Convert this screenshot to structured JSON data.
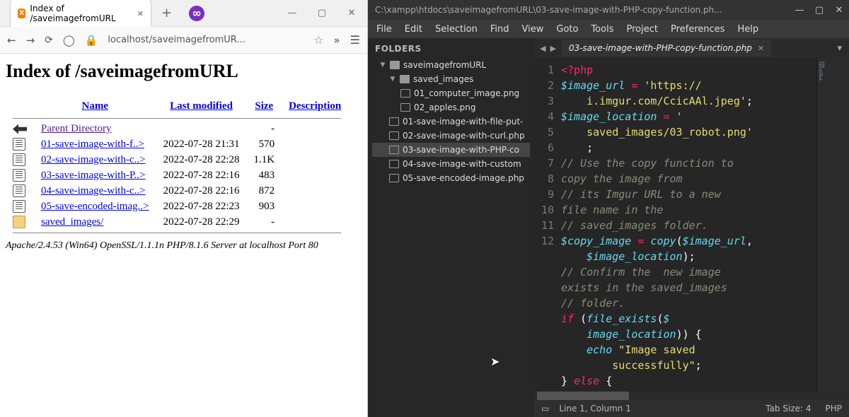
{
  "browser": {
    "tab": {
      "title": "Index of /saveimagefromURL"
    },
    "newtab": "+",
    "address": "localhost/saveimagefromUR...",
    "page": {
      "heading": "Index of /saveimagefromURL",
      "cols": {
        "name": "Name",
        "modified": "Last modified",
        "size": "Size",
        "desc": "Description"
      },
      "parent": "Parent Directory",
      "rows": [
        {
          "name": "01-save-image-with-f..>",
          "modified": "2022-07-28 21:31",
          "size": "570"
        },
        {
          "name": "02-save-image-with-c..>",
          "modified": "2022-07-28 22:28",
          "size": "1.1K"
        },
        {
          "name": "03-save-image-with-P..>",
          "modified": "2022-07-28 22:16",
          "size": "483"
        },
        {
          "name": "04-save-image-with-c..>",
          "modified": "2022-07-28 22:16",
          "size": "872"
        },
        {
          "name": "05-save-encoded-imag..>",
          "modified": "2022-07-28 22:23",
          "size": "903"
        },
        {
          "name": "saved_images/",
          "modified": "2022-07-28 22:29",
          "size": "-",
          "dir": true
        }
      ],
      "server": "Apache/2.4.53 (Win64) OpenSSL/1.1.1n PHP/8.1.6 Server at localhost Port 80"
    }
  },
  "editor": {
    "title": "C:\\xampp\\htdocs\\saveimagefromURL\\03-save-image-with-PHP-copy-function.ph...",
    "menu": [
      "File",
      "Edit",
      "Selection",
      "Find",
      "View",
      "Goto",
      "Tools",
      "Project",
      "Preferences",
      "Help"
    ],
    "folders_label": "FOLDERS",
    "tree": [
      {
        "label": "saveimagefromURL",
        "depth": 1,
        "folder": true,
        "exp": true
      },
      {
        "label": "saved_images",
        "depth": 2,
        "folder": true,
        "exp": true
      },
      {
        "label": "01_computer_image.png",
        "depth": 3
      },
      {
        "label": "02_apples.png",
        "depth": 3
      },
      {
        "label": "01-save-image-with-file-put-",
        "depth": 2
      },
      {
        "label": "02-save-image-with-curl.php",
        "depth": 2
      },
      {
        "label": "03-save-image-with-PHP-co",
        "depth": 2,
        "selected": true
      },
      {
        "label": "04-save-image-with-custom",
        "depth": 2
      },
      {
        "label": "05-save-encoded-image.php",
        "depth": 2
      }
    ],
    "tab": "03-save-image-with-PHP-copy-function.php",
    "lines": [
      "1",
      "2",
      "3",
      "4",
      "5",
      "6",
      "7",
      "8",
      "9",
      "10",
      "11",
      "12"
    ],
    "status": {
      "pos": "Line 1, Column 1",
      "tab": "Tab Size: 4",
      "lang": "PHP"
    }
  }
}
